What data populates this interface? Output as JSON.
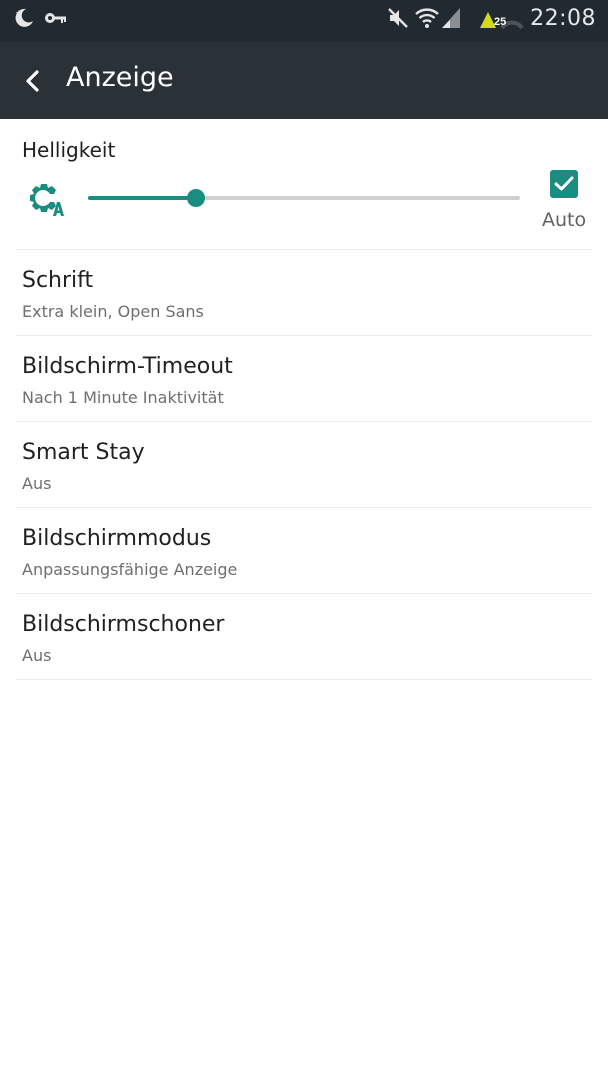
{
  "status_bar": {
    "time": "22:08",
    "battery_level": "25",
    "icons": [
      "moon-star-icon",
      "key-icon",
      "mute-icon",
      "wifi-icon",
      "signal-icon",
      "battery-icon"
    ]
  },
  "app_bar": {
    "title": "Anzeige",
    "back_icon": "chevron-left-icon"
  },
  "brightness": {
    "label": "Helligkeit",
    "icon": "auto-brightness-icon",
    "slider_level": 0.25,
    "auto_label": "Auto",
    "auto_checked": true
  },
  "settings": [
    {
      "title": "Schrift",
      "subtitle": "Extra klein, Open Sans"
    },
    {
      "title": "Bildschirm-Timeout",
      "subtitle": "Nach 1 Minute Inaktivität"
    },
    {
      "title": "Smart Stay",
      "subtitle": "Aus"
    },
    {
      "title": "Bildschirmmodus",
      "subtitle": "Anpassungsfähige Anzeige"
    },
    {
      "title": "Bildschirmschoner",
      "subtitle": "Aus"
    }
  ],
  "colors": {
    "accent": "#1a8c80",
    "app_bar": "#2a3238",
    "status_bar": "#222a31",
    "battery_indicator": "#d4d818"
  }
}
